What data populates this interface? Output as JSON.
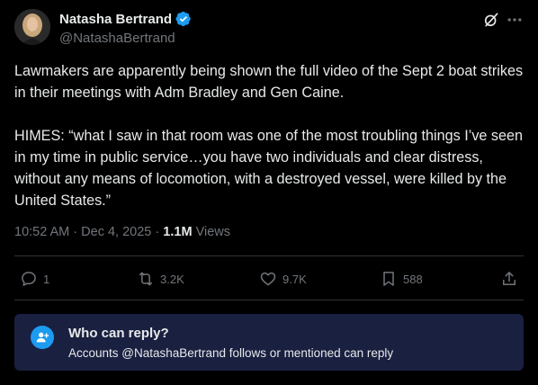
{
  "author": {
    "display_name": "Natasha Bertrand",
    "handle": "@NatashaBertrand",
    "verified": true
  },
  "tweet": {
    "paragraphs": [
      "Lawmakers are apparently being shown the full video of the Sept 2 boat strikes in their meetings with Adm Bradley and Gen Caine.",
      "HIMES: “what I saw in that room was one of the most troubling things I’ve seen in my time in public service…you have two individuals and clear distress, without any means of locomotion, with a destroyed vessel, were killed by the United States.”"
    ],
    "time": "10:52 AM",
    "separator": "·",
    "date": "Dec 4, 2025",
    "views_count": "1.1M",
    "views_label": "Views"
  },
  "actions": {
    "replies": "1",
    "reposts": "3.2K",
    "likes": "9.7K",
    "bookmarks": "588"
  },
  "reply_restriction": {
    "title": "Who can reply?",
    "description": "Accounts @NatashaBertrand follows or mentioned can reply"
  },
  "colors": {
    "background": "#000000",
    "text": "#e7e9ea",
    "muted": "#71767b",
    "accent": "#1d9bf0",
    "reply_box": "#1a2040"
  },
  "icons": [
    "verified-badge-icon",
    "grok-icon",
    "more-icon",
    "reply-icon",
    "repost-icon",
    "like-icon",
    "bookmark-icon",
    "share-icon",
    "person-add-icon"
  ]
}
